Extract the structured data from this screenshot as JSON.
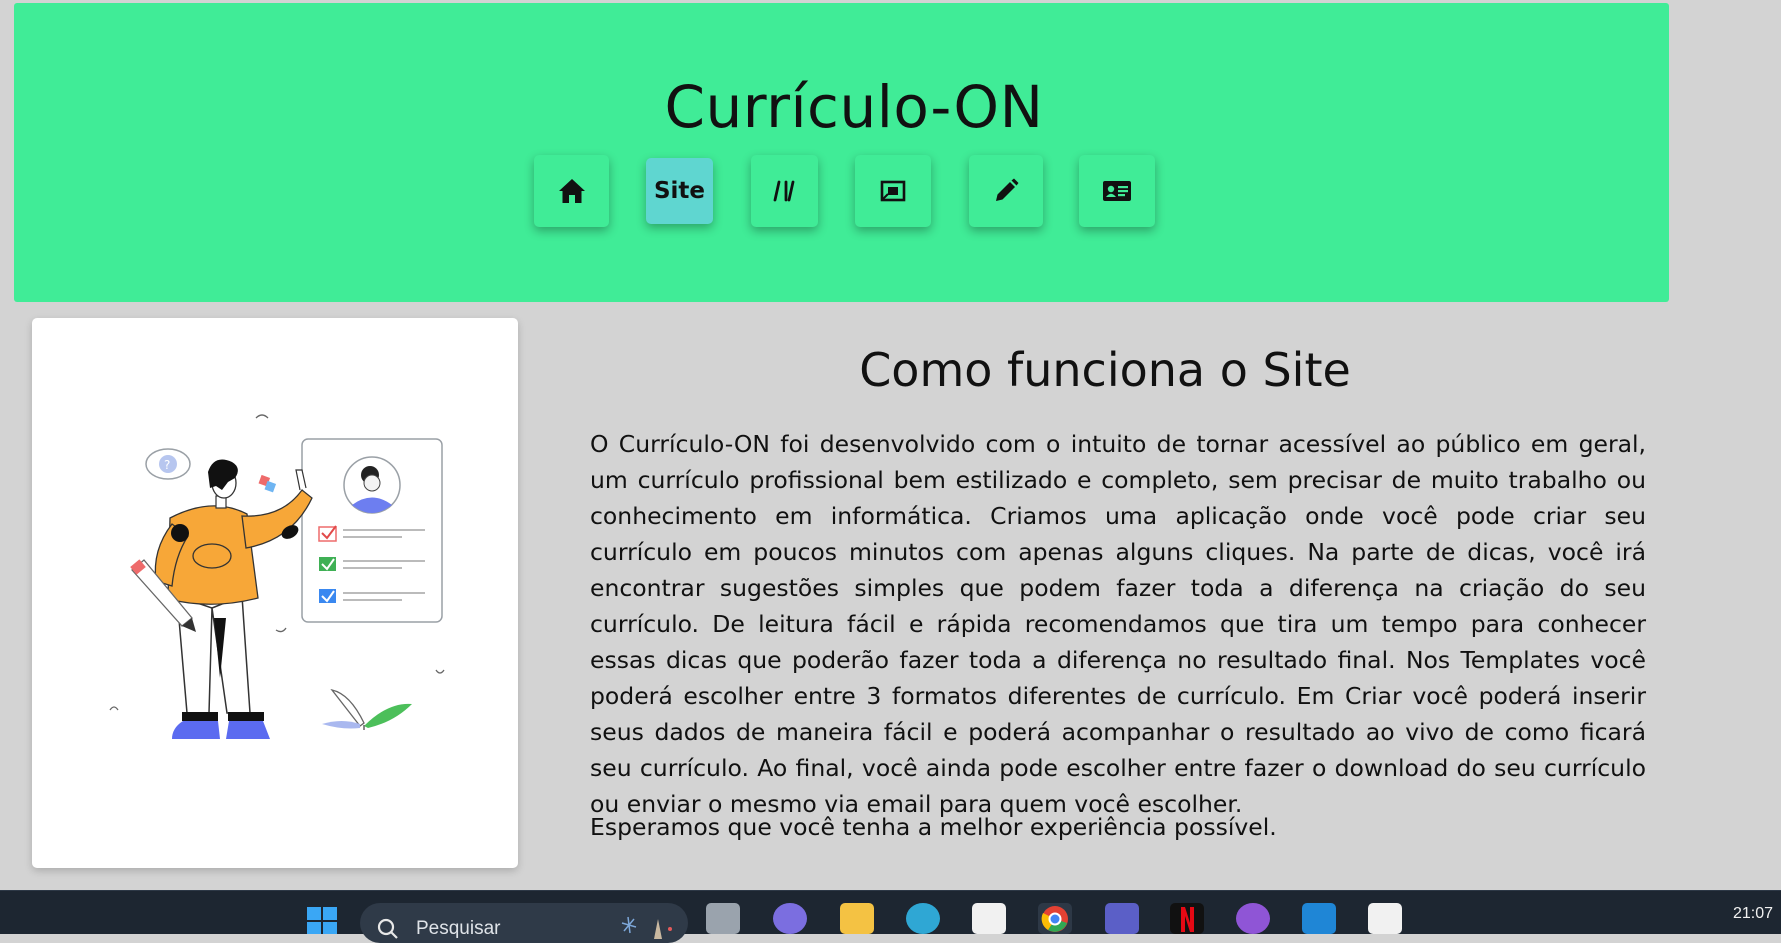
{
  "header": {
    "title": "Currículo-ON",
    "nav": [
      {
        "icon": "home-icon",
        "label": ""
      },
      {
        "icon": "",
        "label": "Site",
        "active": true
      },
      {
        "icon": "library-icon",
        "label": ""
      },
      {
        "icon": "template-icon",
        "label": ""
      },
      {
        "icon": "pencil-icon",
        "label": ""
      },
      {
        "icon": "contact-card-icon",
        "label": ""
      }
    ]
  },
  "main": {
    "title": "Como funciona o Site",
    "paragraph1": "O Currículo-ON foi desenvolvido com o intuito de tornar acessível ao público em geral, um currículo profissional bem estilizado e completo, sem precisar de muito trabalho ou conhecimento em informática. Criamos uma aplicação onde você pode criar seu currículo em poucos minutos com apenas alguns cliques. Na parte de dicas, você irá encontrar sugestões simples que podem fazer toda a diferença na criação do seu currículo. De leitura fácil e rápida recomendamos que tira um tempo para conhecer essas dicas que poderão fazer toda a diferença no resultado final. Nos Templates você poderá escolher entre 3 formatos diferentes de currículo. Em Criar você poderá inserir seus dados de maneira fácil e poderá acompanhar o resultado ao vivo de como ficará seu currículo. Ao final, você ainda pode escolher entre fazer o download do seu currículo ou enviar o mesmo via email para quem você escolher.",
    "paragraph2": "Esperamos que você tenha a melhor experiência possível."
  },
  "taskbar": {
    "search_placeholder": "Pesquisar",
    "time": "21:07",
    "apps": [
      "start-icon",
      "task-view-icon",
      "teams-meet-icon",
      "file-explorer-icon",
      "edge-icon",
      "store-icon",
      "chrome-icon",
      "teams-icon",
      "netflix-icon",
      "github-icon",
      "vscode-icon",
      "snipping-tool-icon"
    ]
  },
  "colors": {
    "header_bg": "#40ec97",
    "active_nav": "#5fd6d0",
    "page_bg": "#d3d3d3",
    "taskbar_bg": "#1d2631"
  }
}
